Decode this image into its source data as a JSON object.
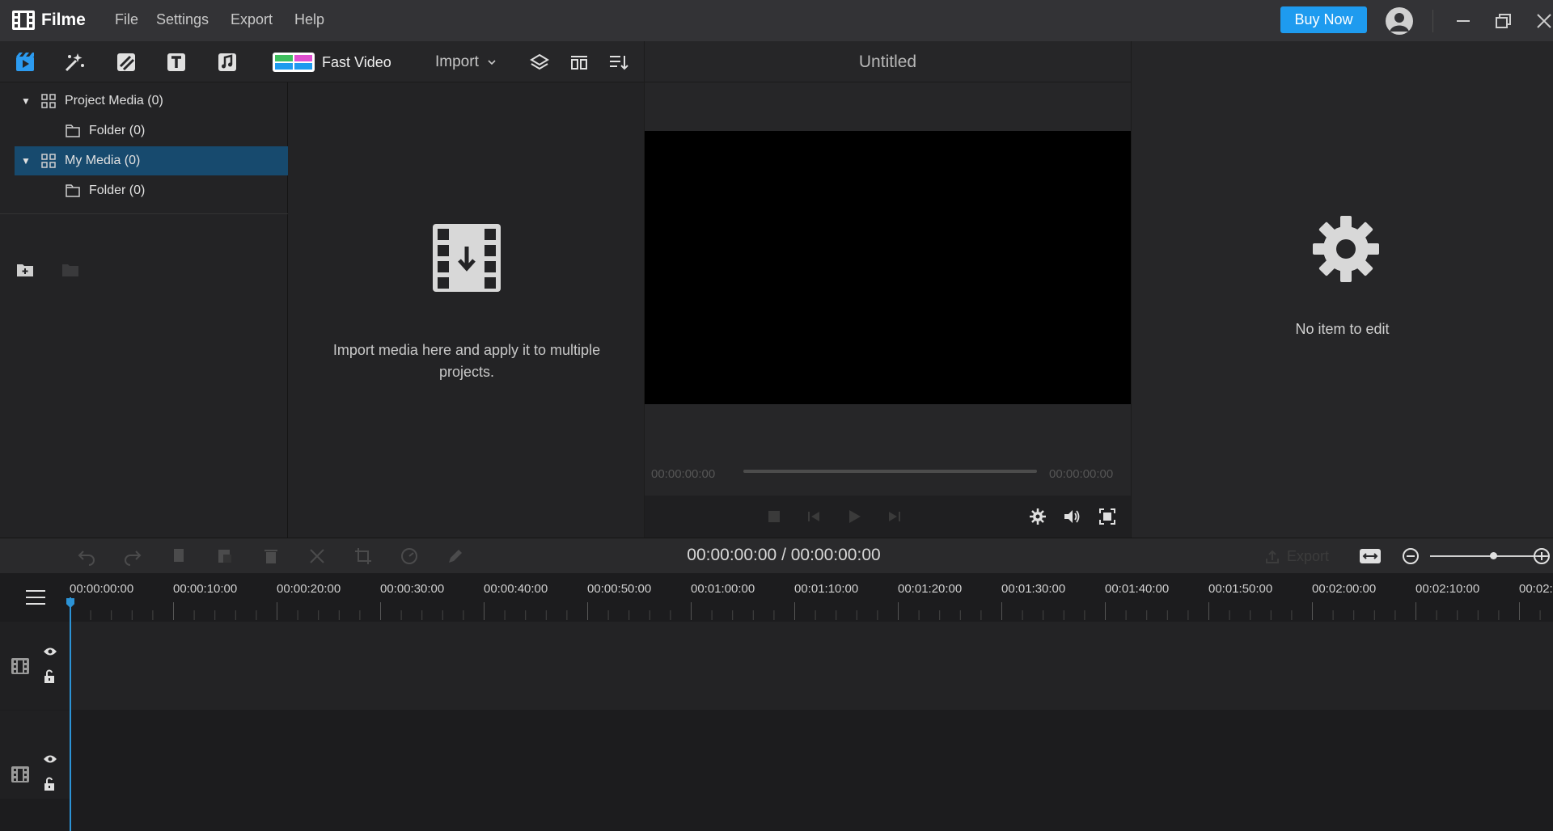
{
  "app": {
    "name": "Filme",
    "menu": [
      "File",
      "Settings",
      "Export",
      "Help"
    ],
    "buy_now": "Buy Now"
  },
  "toolbar": {
    "icons": [
      "media-icon",
      "effects-icon",
      "transitions-icon",
      "text-icon",
      "music-icon"
    ],
    "fast_video": "Fast Video",
    "import": "Import"
  },
  "tree": {
    "items": [
      {
        "label": "Project Media (0)",
        "expanded": true
      },
      {
        "label": "Folder (0)"
      },
      {
        "label": "My Media (0)",
        "expanded": true,
        "selected": true
      },
      {
        "label": "Folder (0)"
      }
    ]
  },
  "media": {
    "hint": "Import media here and apply it to multiple projects."
  },
  "preview": {
    "title": "Untitled",
    "time_start": "00:00:00:00",
    "time_end": "00:00:00:00"
  },
  "properties": {
    "empty_text": "No item to edit"
  },
  "timeline": {
    "current_time": "00:00:00:00 / 00:00:00:00",
    "export_label": "Export",
    "ruler": [
      "00:00:00:00",
      "00:00:10:00",
      "00:00:20:00",
      "00:00:30:00",
      "00:00:40:00",
      "00:00:50:00",
      "00:01:00:00",
      "00:01:10:00",
      "00:01:20:00",
      "00:01:30:00",
      "00:01:40:00",
      "00:01:50:00",
      "00:02:00:00",
      "00:02:10:00",
      "00:02:"
    ]
  },
  "colors": {
    "accent": "#1e9bef",
    "selected_row": "#174a6e",
    "playhead": "#2c93d6"
  }
}
